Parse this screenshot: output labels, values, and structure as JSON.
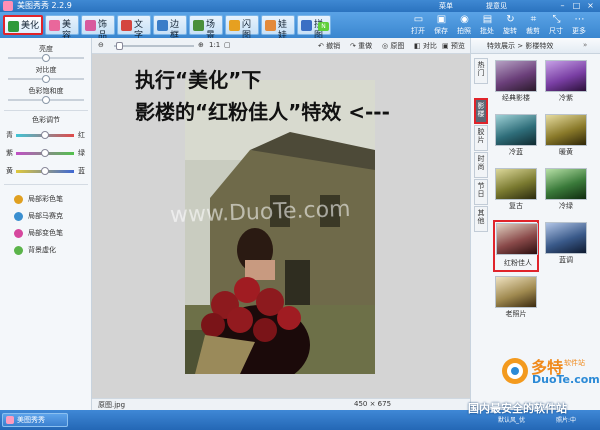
{
  "titlebar": {
    "title": "美图秀秀 2.2.9",
    "menu": "菜单",
    "feedback": "提意见"
  },
  "tabs": [
    {
      "label": "美化",
      "color": "#2f9a3c"
    },
    {
      "label": "美容",
      "color": "#e9679b"
    },
    {
      "label": "饰品",
      "color": "#d85a9e"
    },
    {
      "label": "文字",
      "color": "#d4453f"
    },
    {
      "label": "边框",
      "color": "#3a7dc8"
    },
    {
      "label": "场景",
      "color": "#4a8f3a"
    },
    {
      "label": "闪图",
      "color": "#e6a020"
    },
    {
      "label": "娃娃",
      "color": "#e38a3b"
    },
    {
      "label": "拼图",
      "color": "#3b6fc4"
    }
  ],
  "toolbar_buttons": [
    {
      "label": "打开",
      "icon": "▭"
    },
    {
      "label": "保存",
      "icon": "▣"
    },
    {
      "label": "拍照",
      "icon": "◉"
    },
    {
      "label": "批处",
      "icon": "▤"
    },
    {
      "label": "旋转",
      "icon": "↻"
    },
    {
      "label": "裁剪",
      "icon": "⌗"
    },
    {
      "label": "尺寸",
      "icon": "⤡"
    },
    {
      "label": "更多",
      "icon": "⋯"
    }
  ],
  "left_panel": {
    "sliders": [
      {
        "label": "亮度",
        "value": 0.5
      },
      {
        "label": "对比度",
        "value": 0.5
      },
      {
        "label": "色彩饱和度",
        "value": 0.5
      }
    ],
    "color_adjust": {
      "title": "色彩调节",
      "rows": [
        {
          "left": "青",
          "right": "红",
          "value": 0.5
        },
        {
          "left": "紫",
          "right": "绿",
          "value": 0.5
        },
        {
          "left": "黄",
          "right": "蓝",
          "value": 0.5
        }
      ]
    },
    "brushes": [
      {
        "label": "局部彩色笔",
        "color": "#e0a020"
      },
      {
        "label": "局部马赛克",
        "color": "#3a8fd0"
      },
      {
        "label": "局部变色笔",
        "color": "#d6489e"
      },
      {
        "label": "背景虚化",
        "color": "#5bb44a"
      }
    ]
  },
  "canvas_toolbar": {
    "zoom": "1:1",
    "undo": "撤销",
    "redo": "重做",
    "original": "原图",
    "compare": "对比",
    "preview": "预览"
  },
  "statusbar": {
    "file_name": "原图.jpg",
    "image_size": "450 × 675"
  },
  "effects": {
    "header": "特效展示 > 影楼特效",
    "vertical_tabs": [
      "热门",
      "影楼",
      "胶片",
      "时尚",
      "节日",
      "其他"
    ],
    "thumbnails": [
      {
        "label": "经典影楼",
        "tint": "#6b3f7a"
      },
      {
        "label": "冷紫",
        "tint": "#7a3fa4"
      },
      {
        "label": "冷蓝",
        "tint": "#2f6e7a"
      },
      {
        "label": "暖黄",
        "tint": "#8a7a2a"
      },
      {
        "label": "复古",
        "tint": "#7a7a30"
      },
      {
        "label": "冷绿",
        "tint": "#3a7a3a"
      },
      {
        "label": "红粉佳人",
        "tint": "#8a4a4a"
      },
      {
        "label": "蓝调",
        "tint": "#3a5a8a"
      },
      {
        "label": "老照片",
        "tint": "#a08a50"
      }
    ]
  },
  "annotation": {
    "line1": "执行“美化”下",
    "line2": "影楼的“红粉佳人”特效 <---",
    "watermark": "www.DuoTe.com"
  },
  "branding": {
    "site_name": "多特",
    "site_name_small": "软件站",
    "site_domain": "DuoTe.com",
    "slogan": "国内最安全的软件站"
  },
  "taskbar": {
    "app": "美图秀秀",
    "right1": "默认风_优",
    "right2": "照片:中"
  },
  "highlight_color": "#e0242b"
}
